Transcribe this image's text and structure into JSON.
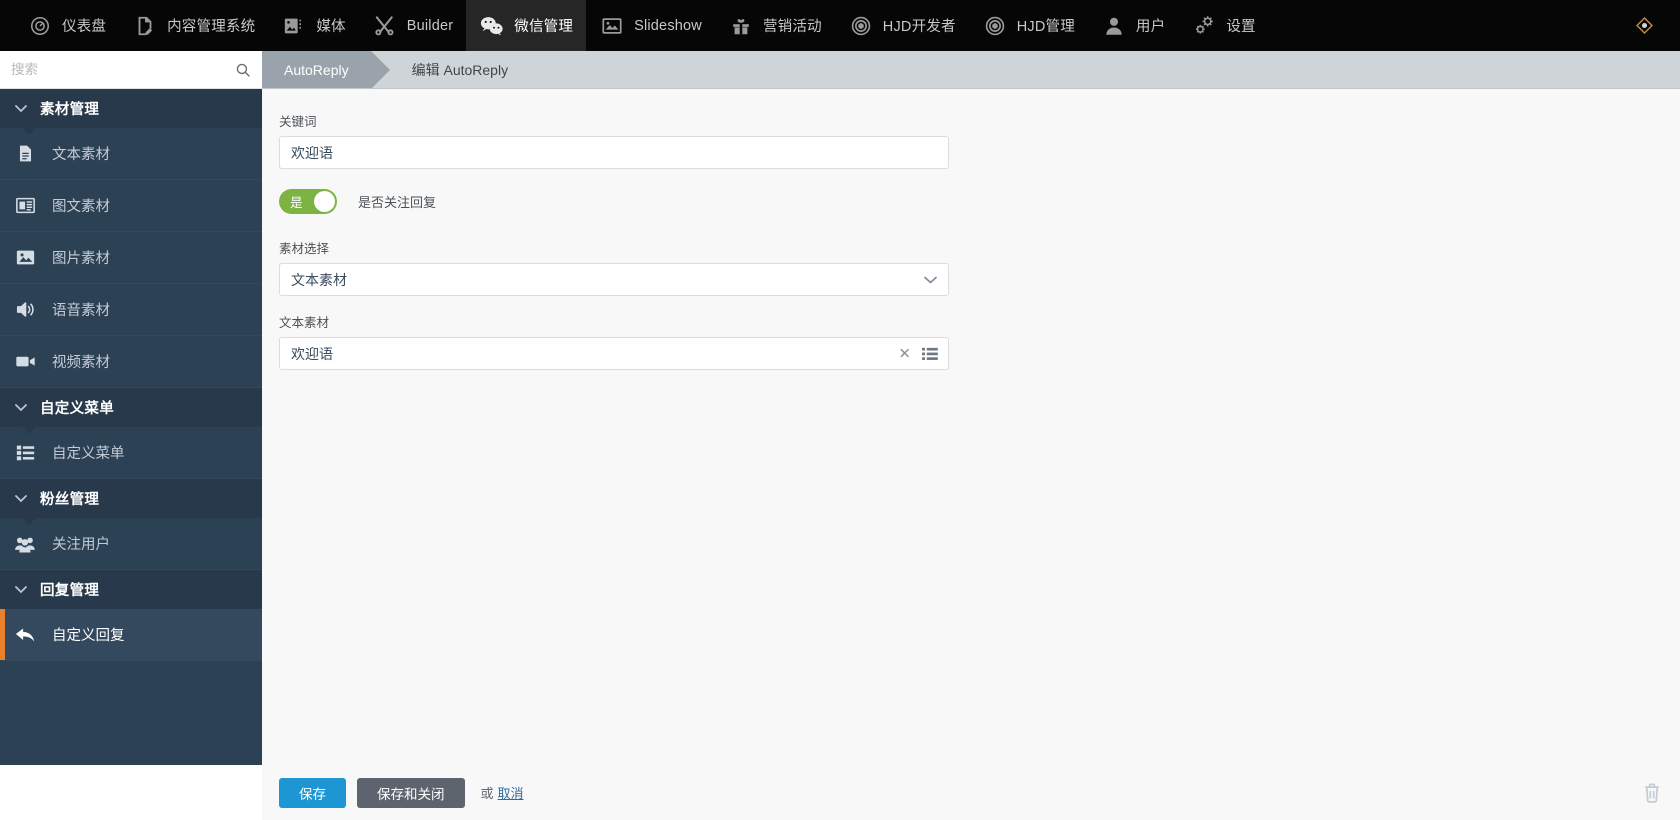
{
  "topnav": {
    "items": [
      {
        "label": "仪表盘",
        "icon": "gauge-icon",
        "active": false
      },
      {
        "label": "内容管理系统",
        "icon": "cms-document-icon",
        "active": false
      },
      {
        "label": "媒体",
        "icon": "media-image-icon",
        "active": false
      },
      {
        "label": "Builder",
        "icon": "tools-icon",
        "active": false
      },
      {
        "label": "微信管理",
        "icon": "wechat-icon",
        "active": true
      },
      {
        "label": "Slideshow",
        "icon": "slideshow-icon",
        "active": false
      },
      {
        "label": "营销活动",
        "icon": "gift-icon",
        "active": false
      },
      {
        "label": "HJD开发者",
        "icon": "target-icon",
        "active": false
      },
      {
        "label": "HJD管理",
        "icon": "target-icon",
        "active": false
      },
      {
        "label": "用户",
        "icon": "user-icon",
        "active": false
      },
      {
        "label": "设置",
        "icon": "gears-icon",
        "active": false
      }
    ],
    "right_icon": "compass-diamond-icon"
  },
  "sidebar": {
    "search": {
      "placeholder": "搜索",
      "value": "",
      "icon": "search-icon"
    },
    "groups": [
      {
        "header": "素材管理",
        "caret": "chevron-down-icon",
        "items": [
          {
            "label": "文本素材",
            "icon": "text-document-icon",
            "active": false
          },
          {
            "label": "图文素材",
            "icon": "article-icon",
            "active": false
          },
          {
            "label": "图片素材",
            "icon": "picture-icon",
            "active": false
          },
          {
            "label": "语音素材",
            "icon": "speaker-icon",
            "active": false
          },
          {
            "label": "视频素材",
            "icon": "video-camera-icon",
            "active": false
          }
        ]
      },
      {
        "header": "自定义菜单",
        "caret": "chevron-down-icon",
        "items": [
          {
            "label": "自定义菜单",
            "icon": "list-icon",
            "active": false
          }
        ]
      },
      {
        "header": "粉丝管理",
        "caret": "chevron-down-icon",
        "items": [
          {
            "label": "关注用户",
            "icon": "users-group-icon",
            "active": false
          }
        ]
      },
      {
        "header": "回复管理",
        "caret": "chevron-down-icon",
        "items": [
          {
            "label": "自定义回复",
            "icon": "reply-arrow-icon",
            "active": true
          }
        ]
      }
    ]
  },
  "breadcrumb": {
    "active": "AutoReply",
    "current": "编辑 AutoReply"
  },
  "form": {
    "keyword": {
      "label": "关键词",
      "value": "欢迎语",
      "placeholder": ""
    },
    "subscribe_toggle": {
      "state_text": "是",
      "label": "是否关注回复",
      "on": true,
      "color": "#7cb342"
    },
    "material_type": {
      "label": "素材选择",
      "value": "文本素材",
      "caret": "chevron-down-icon"
    },
    "text_material": {
      "label": "文本素材",
      "value": "欢迎语",
      "clear_icon": "close-x-icon",
      "list_icon": "list-picker-icon"
    }
  },
  "footer": {
    "save_label": "保存",
    "save_close_label": "保存和关闭",
    "or_text": "或",
    "cancel_label": "取消",
    "delete_icon": "trash-icon"
  },
  "colors": {
    "accent_blue": "#1e96d4",
    "sidebar_bg": "#2d4154",
    "sidebar_header_bg": "#27394a",
    "active_marker": "#e8812a",
    "topnav_bg": "#060606",
    "toggle_green": "#7cb342"
  }
}
